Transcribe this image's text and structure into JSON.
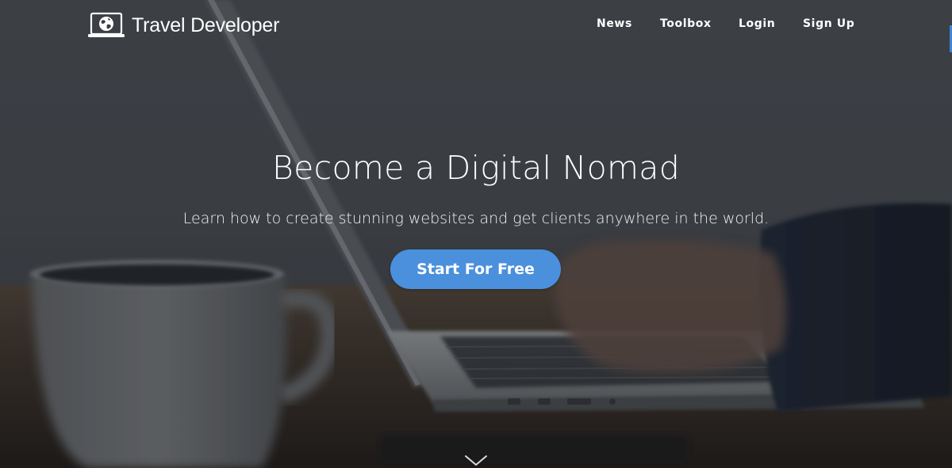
{
  "brand": {
    "name": "Travel Developer",
    "icon": "laptop-globe-icon"
  },
  "nav": {
    "items": [
      {
        "label": "News"
      },
      {
        "label": "Toolbox"
      },
      {
        "label": "Login"
      },
      {
        "label": "Sign Up"
      }
    ]
  },
  "hero": {
    "title": "Become a Digital Nomad",
    "subtitle": "Learn how to create stunning websites and get clients anywhere in the world.",
    "cta_label": "Start For Free",
    "scroll_icon": "chevron-down-icon"
  },
  "colors": {
    "accent": "#4a90dc",
    "text": "#ffffff",
    "background": "#3b3f44"
  }
}
